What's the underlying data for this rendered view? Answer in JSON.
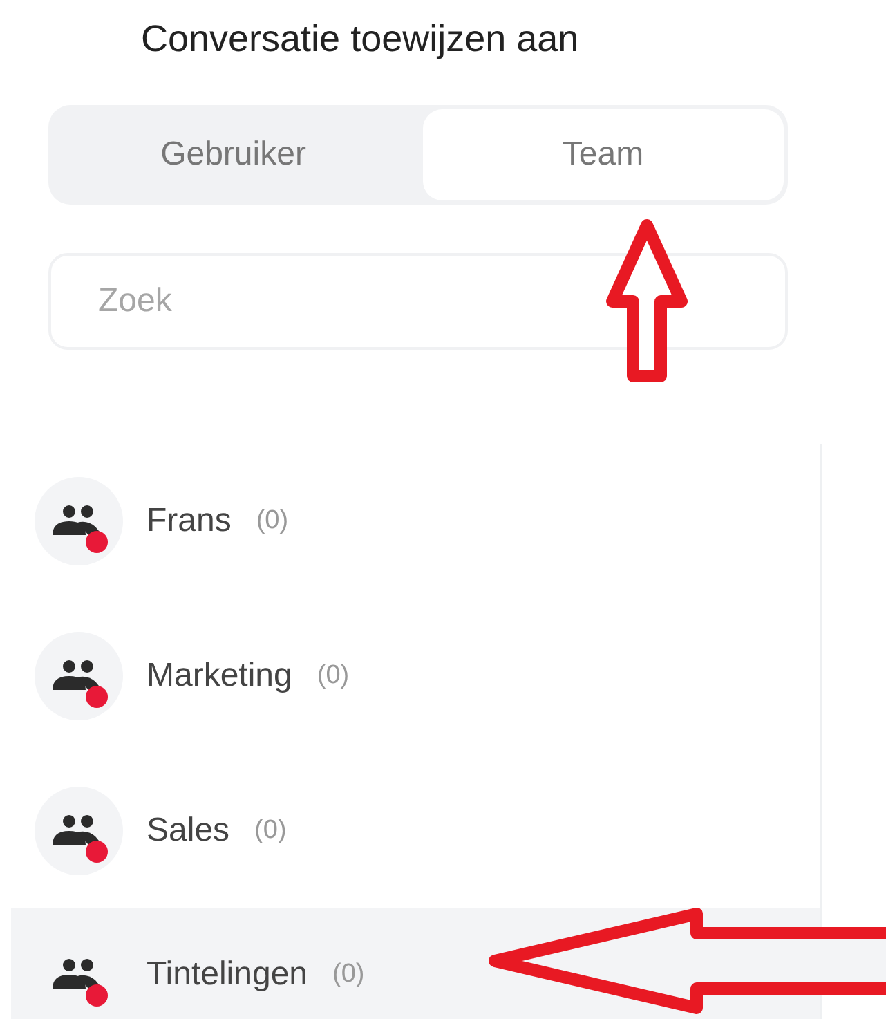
{
  "title": "Conversatie toewijzen aan",
  "tabs": [
    {
      "label": "Gebruiker",
      "selected": false
    },
    {
      "label": "Team",
      "selected": true
    }
  ],
  "search": {
    "placeholder": "Zoek"
  },
  "teams": [
    {
      "name": "Frans",
      "count": "(0)",
      "selected": false
    },
    {
      "name": "Marketing",
      "count": "(0)",
      "selected": false
    },
    {
      "name": "Sales",
      "count": "(0)",
      "selected": false
    },
    {
      "name": "Tintelingen",
      "count": "(0)",
      "selected": true
    }
  ]
}
